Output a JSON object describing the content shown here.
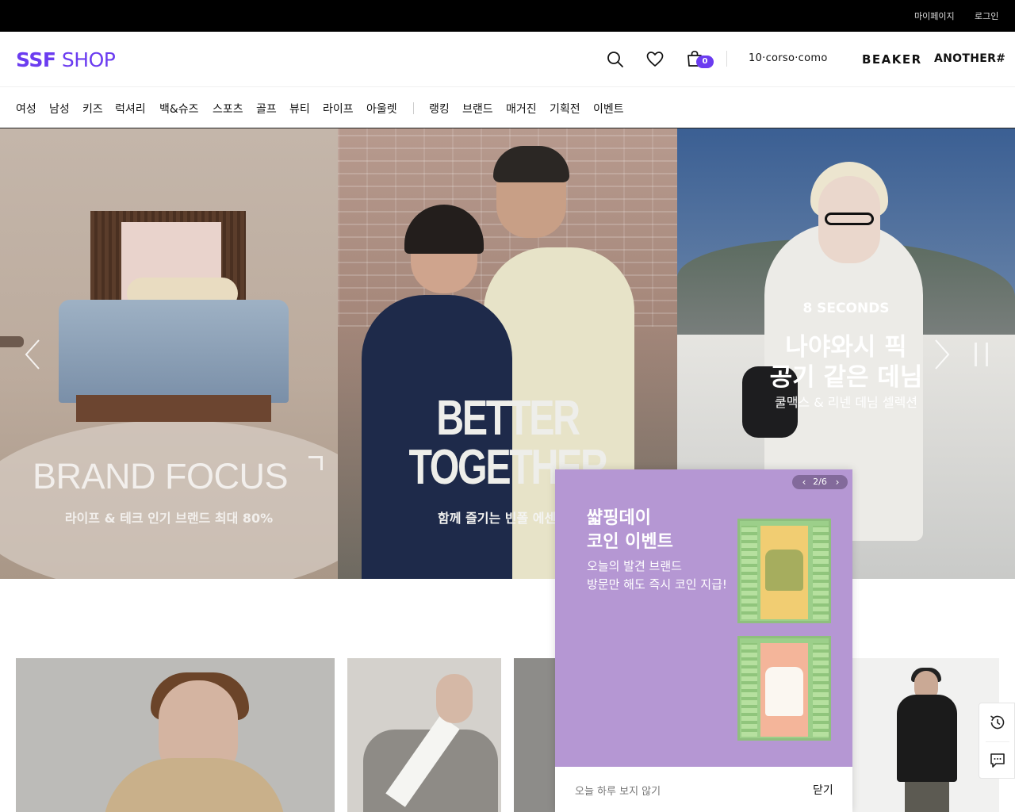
{
  "topbar": {
    "mypage": "마이페이지",
    "login": "로그인"
  },
  "header": {
    "logo_bold": "SSF",
    "logo_light": " SHOP",
    "cart_count": "0",
    "brands": [
      "10·corso·como",
      "BEAKER",
      "ANOTHER#"
    ],
    "accent_color": "#6b3cf0"
  },
  "nav": {
    "categories": [
      "여성",
      "남성",
      "키즈",
      "럭셔리",
      "백&슈즈",
      "스포츠",
      "골프",
      "뷰티",
      "라이프",
      "아울렛"
    ],
    "special": [
      "랭킹",
      "브랜드",
      "매거진",
      "기획전",
      "이벤트"
    ]
  },
  "hero": {
    "slide1": {
      "title": "BRAND FOCUS",
      "subtitle": "라이프 & 테크 인기 브랜드 최대 80%"
    },
    "slide2": {
      "title_line1": "BETTER",
      "title_line2": "TOGETHER",
      "subtitle": "함께 즐기는 빈폴 에센"
    },
    "slide3": {
      "brand": "8 SECONDS",
      "title_line1": "나야와시 픽",
      "title_line2": "공기 같은 데님",
      "subtitle": "쿨맥스 & 리넨 데님 셀렉션"
    }
  },
  "popup": {
    "pager": "2/6",
    "title_line1": "쌻핑데이",
    "title_line2": "코인 이벤트",
    "desc_line1": "오늘의 발견 브랜드",
    "desc_line2": "방문만 해도 즉시 코인 지급!",
    "dont_show_today": "오늘 하루 보지 않기",
    "close": "닫기",
    "background_color": "#b597d3"
  },
  "float_tools": {
    "icons": [
      "history-icon",
      "chat-icon"
    ]
  }
}
